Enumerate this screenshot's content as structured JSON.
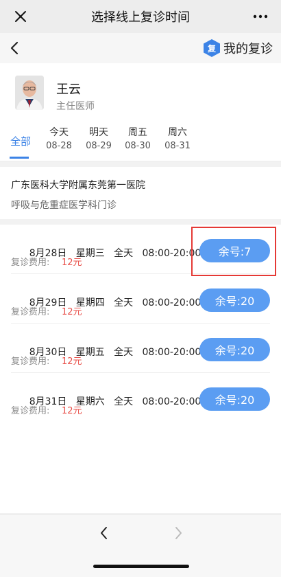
{
  "titlebar": {
    "title": "选择线上复诊时间",
    "close_icon": "close-icon",
    "more_icon": "more-dots-icon"
  },
  "navbar": {
    "back_icon": "chevron-left-icon",
    "mine_badge": "复",
    "mine_label": "我的复诊"
  },
  "doctor": {
    "name": "王云",
    "title": "主任医师"
  },
  "tabs": {
    "all_label": "全部",
    "days": [
      {
        "day": "今天",
        "date": "08-28"
      },
      {
        "day": "明天",
        "date": "08-29"
      },
      {
        "day": "周五",
        "date": "08-30"
      },
      {
        "day": "周六",
        "date": "08-31"
      }
    ]
  },
  "hospital": {
    "name": "广东医科大学附属东莞第一医院",
    "department": "呼吸与危重症医学科门诊"
  },
  "slots": [
    {
      "date": "8月28日",
      "weekday": "星期三",
      "period": "全天",
      "time": "08:00-20:00",
      "fee_label": "复诊费用:",
      "fee": "12元",
      "remaining": "余号:7"
    },
    {
      "date": "8月29日",
      "weekday": "星期四",
      "period": "全天",
      "time": "08:00-20:00",
      "fee_label": "复诊费用:",
      "fee": "12元",
      "remaining": "余号:20"
    },
    {
      "date": "8月30日",
      "weekday": "星期五",
      "period": "全天",
      "time": "08:00-20:00",
      "fee_label": "复诊费用:",
      "fee": "12元",
      "remaining": "余号:20"
    },
    {
      "date": "8月31日",
      "weekday": "星期六",
      "period": "全天",
      "time": "08:00-20:00",
      "fee_label": "复诊费用:",
      "fee": "12元",
      "remaining": "余号:20"
    }
  ],
  "colors": {
    "accent": "#3c83e6",
    "button": "#5b9df2",
    "fee": "#e8504a",
    "highlight": "#e53935"
  }
}
